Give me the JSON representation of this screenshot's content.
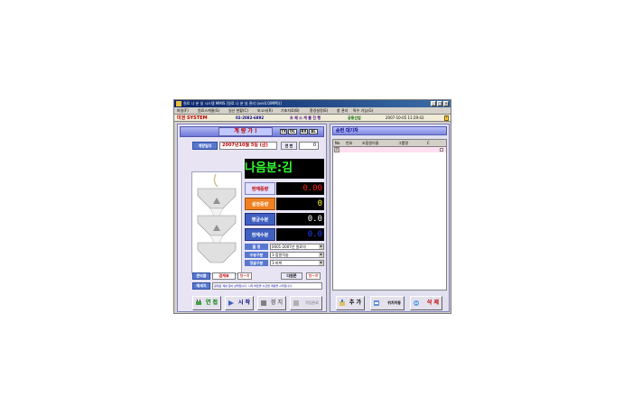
{
  "window": {
    "title": "원료 나 분 실 시스템 MMIS [원료 나 분 실 관리 (ver4.0/MP0)]"
  },
  "menu": [
    "파일(F)",
    "원료스케줄(S)",
    "일산 현황(C)",
    "보고서(R)",
    "기초자료(B)",
    "환경설정(E)",
    "창 관리",
    "특수 기능(G)"
  ],
  "statusbar": {
    "logo": "미권 SYSTEM",
    "tel": "02-2082-6892",
    "center": "조 제 스 케 쥴 진 행",
    "company": "공동산업",
    "datetime": "2007-10-05 11:29:42",
    "warn": "!"
  },
  "left": {
    "title": "계 량 가 !",
    "mini": [
      "TX",
      "OL",
      "RX",
      "AL"
    ],
    "date_label": "계량일자",
    "date_value": "2007년10월 5일 (금)",
    "seq_label": "연 번",
    "seq_value": "0",
    "ticker": "나음분:김",
    "weights": [
      {
        "label": "현재중량",
        "value": "0.00",
        "label_color": "#c00000",
        "value_color": "#ff2020",
        "label_bg": "#e0e0ff"
      },
      {
        "label": "설정중량",
        "value": "0",
        "label_color": "#ffffff",
        "value_color": "#ffff40",
        "label_bg": "#f08020"
      },
      {
        "label": "평균수분",
        "value": "0.0",
        "label_color": "#ffffff",
        "value_color": "#ffffff",
        "label_bg": "#4060c0"
      },
      {
        "label": "현재수분",
        "value": "0.0",
        "label_color": "#ffffff",
        "value_color": "#2040ff",
        "label_bg": "#4060c0"
      }
    ],
    "combos": [
      {
        "label": "품 명",
        "value": "0001-2007년 원료의"
      },
      {
        "label": "수송구분",
        "value": "1-합원작숭"
      },
      {
        "label": "정글구분",
        "value": "1-마취"
      }
    ],
    "row_buttons": {
      "label1": "준비품",
      "btn1": "검계표",
      "btn2": "형~여",
      "label2": "다원문",
      "btn3": "형~여"
    },
    "message_label": "메세지",
    "message_text": "원재료 계량 준비 상태입니다. 시작 버튼을 누르면 계량을 시작합니다.",
    "buttons": [
      "연 접",
      "시 작",
      "정 지",
      "작업완료"
    ]
  },
  "right": {
    "title": "순번 대기자",
    "grid_columns": [
      "No",
      "번호",
      "조합원이름",
      "그룹명",
      "C"
    ],
    "grid_rows": [
      {
        "sel": "I",
        "cells": [
          "",
          "",
          "",
          ""
        ]
      }
    ],
    "buttons": [
      "추 가",
      "위치이동",
      "삭 제"
    ]
  }
}
